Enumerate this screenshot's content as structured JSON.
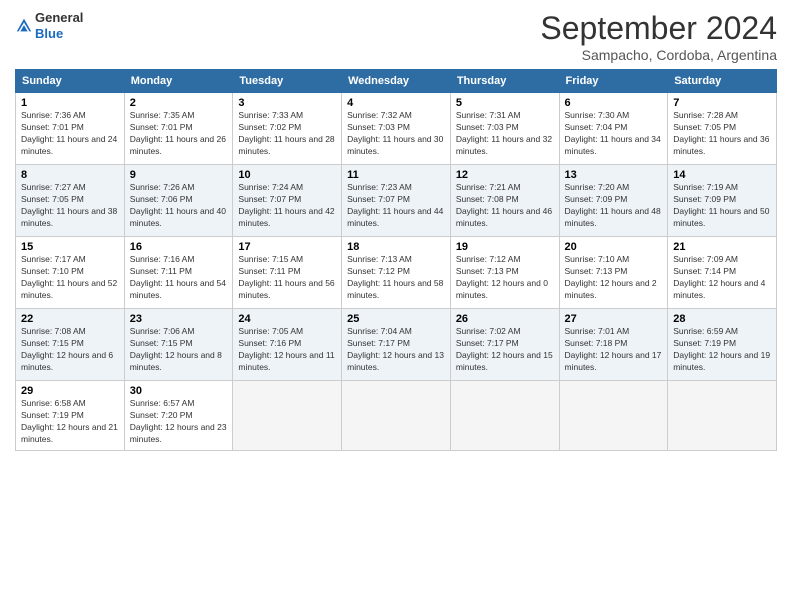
{
  "logo": {
    "general": "General",
    "blue": "Blue"
  },
  "title": "September 2024",
  "subtitle": "Sampacho, Cordoba, Argentina",
  "days_of_week": [
    "Sunday",
    "Monday",
    "Tuesday",
    "Wednesday",
    "Thursday",
    "Friday",
    "Saturday"
  ],
  "weeks": [
    [
      {
        "num": "1",
        "sunrise": "7:36 AM",
        "sunset": "7:01 PM",
        "daylight": "11 hours and 24 minutes."
      },
      {
        "num": "2",
        "sunrise": "7:35 AM",
        "sunset": "7:01 PM",
        "daylight": "11 hours and 26 minutes."
      },
      {
        "num": "3",
        "sunrise": "7:33 AM",
        "sunset": "7:02 PM",
        "daylight": "11 hours and 28 minutes."
      },
      {
        "num": "4",
        "sunrise": "7:32 AM",
        "sunset": "7:03 PM",
        "daylight": "11 hours and 30 minutes."
      },
      {
        "num": "5",
        "sunrise": "7:31 AM",
        "sunset": "7:03 PM",
        "daylight": "11 hours and 32 minutes."
      },
      {
        "num": "6",
        "sunrise": "7:30 AM",
        "sunset": "7:04 PM",
        "daylight": "11 hours and 34 minutes."
      },
      {
        "num": "7",
        "sunrise": "7:28 AM",
        "sunset": "7:05 PM",
        "daylight": "11 hours and 36 minutes."
      }
    ],
    [
      {
        "num": "8",
        "sunrise": "7:27 AM",
        "sunset": "7:05 PM",
        "daylight": "11 hours and 38 minutes."
      },
      {
        "num": "9",
        "sunrise": "7:26 AM",
        "sunset": "7:06 PM",
        "daylight": "11 hours and 40 minutes."
      },
      {
        "num": "10",
        "sunrise": "7:24 AM",
        "sunset": "7:07 PM",
        "daylight": "11 hours and 42 minutes."
      },
      {
        "num": "11",
        "sunrise": "7:23 AM",
        "sunset": "7:07 PM",
        "daylight": "11 hours and 44 minutes."
      },
      {
        "num": "12",
        "sunrise": "7:21 AM",
        "sunset": "7:08 PM",
        "daylight": "11 hours and 46 minutes."
      },
      {
        "num": "13",
        "sunrise": "7:20 AM",
        "sunset": "7:09 PM",
        "daylight": "11 hours and 48 minutes."
      },
      {
        "num": "14",
        "sunrise": "7:19 AM",
        "sunset": "7:09 PM",
        "daylight": "11 hours and 50 minutes."
      }
    ],
    [
      {
        "num": "15",
        "sunrise": "7:17 AM",
        "sunset": "7:10 PM",
        "daylight": "11 hours and 52 minutes."
      },
      {
        "num": "16",
        "sunrise": "7:16 AM",
        "sunset": "7:11 PM",
        "daylight": "11 hours and 54 minutes."
      },
      {
        "num": "17",
        "sunrise": "7:15 AM",
        "sunset": "7:11 PM",
        "daylight": "11 hours and 56 minutes."
      },
      {
        "num": "18",
        "sunrise": "7:13 AM",
        "sunset": "7:12 PM",
        "daylight": "11 hours and 58 minutes."
      },
      {
        "num": "19",
        "sunrise": "7:12 AM",
        "sunset": "7:13 PM",
        "daylight": "12 hours and 0 minutes."
      },
      {
        "num": "20",
        "sunrise": "7:10 AM",
        "sunset": "7:13 PM",
        "daylight": "12 hours and 2 minutes."
      },
      {
        "num": "21",
        "sunrise": "7:09 AM",
        "sunset": "7:14 PM",
        "daylight": "12 hours and 4 minutes."
      }
    ],
    [
      {
        "num": "22",
        "sunrise": "7:08 AM",
        "sunset": "7:15 PM",
        "daylight": "12 hours and 6 minutes."
      },
      {
        "num": "23",
        "sunrise": "7:06 AM",
        "sunset": "7:15 PM",
        "daylight": "12 hours and 8 minutes."
      },
      {
        "num": "24",
        "sunrise": "7:05 AM",
        "sunset": "7:16 PM",
        "daylight": "12 hours and 11 minutes."
      },
      {
        "num": "25",
        "sunrise": "7:04 AM",
        "sunset": "7:17 PM",
        "daylight": "12 hours and 13 minutes."
      },
      {
        "num": "26",
        "sunrise": "7:02 AM",
        "sunset": "7:17 PM",
        "daylight": "12 hours and 15 minutes."
      },
      {
        "num": "27",
        "sunrise": "7:01 AM",
        "sunset": "7:18 PM",
        "daylight": "12 hours and 17 minutes."
      },
      {
        "num": "28",
        "sunrise": "6:59 AM",
        "sunset": "7:19 PM",
        "daylight": "12 hours and 19 minutes."
      }
    ],
    [
      {
        "num": "29",
        "sunrise": "6:58 AM",
        "sunset": "7:19 PM",
        "daylight": "12 hours and 21 minutes."
      },
      {
        "num": "30",
        "sunrise": "6:57 AM",
        "sunset": "7:20 PM",
        "daylight": "12 hours and 23 minutes."
      },
      null,
      null,
      null,
      null,
      null
    ]
  ]
}
